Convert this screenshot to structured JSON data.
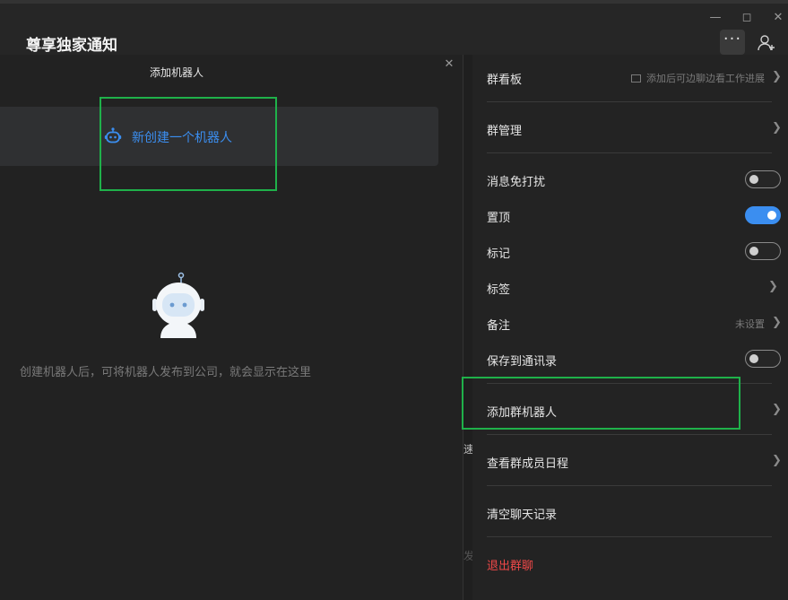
{
  "window": {
    "title": "尊享独家通知"
  },
  "dialog": {
    "title": "添加机器人",
    "create_label": "新创建一个机器人",
    "empty_text": "创建机器人后，可将机器人发布到公司，就会显示在这里"
  },
  "peek": {
    "text_a": "速",
    "text_b": "发"
  },
  "panel": {
    "board": {
      "label": "群看板",
      "hint": "添加后可边聊边看工作进展"
    },
    "manage": {
      "label": "群管理"
    },
    "mute": {
      "label": "消息免打扰",
      "on": false
    },
    "pin": {
      "label": "置顶",
      "on": true
    },
    "mark": {
      "label": "标记",
      "on": false
    },
    "tags": {
      "label": "标签"
    },
    "remark": {
      "label": "备注",
      "hint": "未设置"
    },
    "contacts": {
      "label": "保存到通讯录",
      "on": false
    },
    "add_bot": {
      "label": "添加群机器人"
    },
    "schedule": {
      "label": "查看群成员日程"
    },
    "clear": {
      "label": "清空聊天记录"
    },
    "leave": {
      "label": "退出群聊"
    }
  },
  "colors": {
    "accent": "#3b8ef0",
    "danger": "#f04848",
    "highlight": "#1fb14a"
  }
}
